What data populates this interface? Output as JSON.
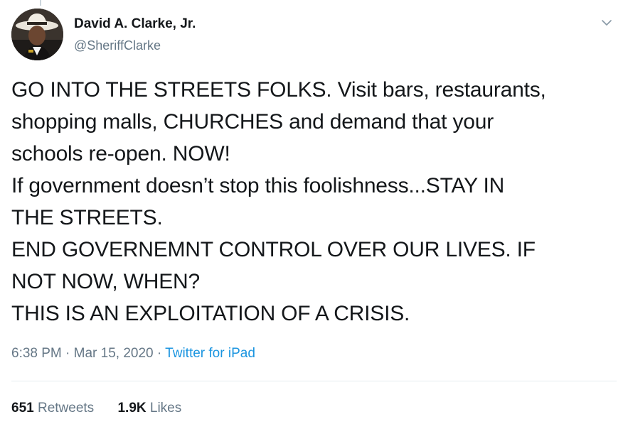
{
  "author": {
    "display_name": "David A. Clarke, Jr.",
    "handle": "@SheriffClarke"
  },
  "tweet": {
    "text": "GO INTO THE STREETS FOLKS. Visit bars, restaurants,\nshopping malls, CHURCHES and demand that your\nschools re-open. NOW!\nIf government doesn’t stop this foolishness...STAY IN\nTHE STREETS.\nEND GOVERNEMNT CONTROL OVER OUR LIVES. IF\nNOT NOW, WHEN?\nTHIS IS AN EXPLOITATION OF A CRISIS.",
    "time": "6:38 PM",
    "separator": "·",
    "date": "Mar 15, 2020",
    "source": "Twitter for iPad"
  },
  "stats": {
    "retweets_count": "651",
    "retweets_label": "Retweets",
    "likes_count": "1.9K",
    "likes_label": "Likes"
  },
  "icons": {
    "menu": "chevron-down-icon"
  },
  "colors": {
    "text": "#14171a",
    "secondary": "#657786",
    "link": "#1b95e0",
    "divider": "#e6ecf0"
  }
}
